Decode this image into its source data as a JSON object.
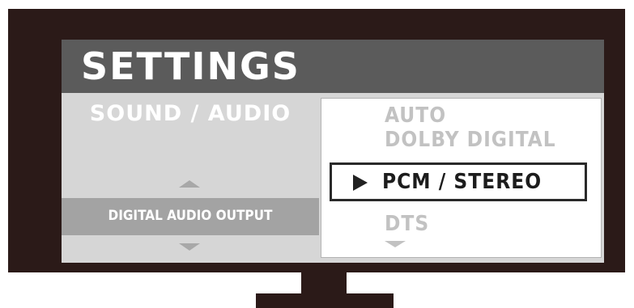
{
  "screen": {
    "title": "SETTINGS",
    "left_panel": {
      "category": "SOUND / AUDIO",
      "option": "DIGITAL AUDIO OUTPUT"
    },
    "dropdown": {
      "options": [
        "AUTO",
        "DOLBY DIGITAL",
        "PCM / STEREO",
        "DTS"
      ],
      "selected": "PCM / STEREO"
    }
  },
  "colors": {
    "tv_frame": "#2b1a18",
    "title_bar": "#5b5b5b",
    "screen_bg": "#d6d6d6",
    "highlight_row": "#a3a3a3",
    "dropdown_bg": "#ffffff",
    "inactive_text": "#c2c2c2",
    "selected_text": "#1c1c1c"
  }
}
